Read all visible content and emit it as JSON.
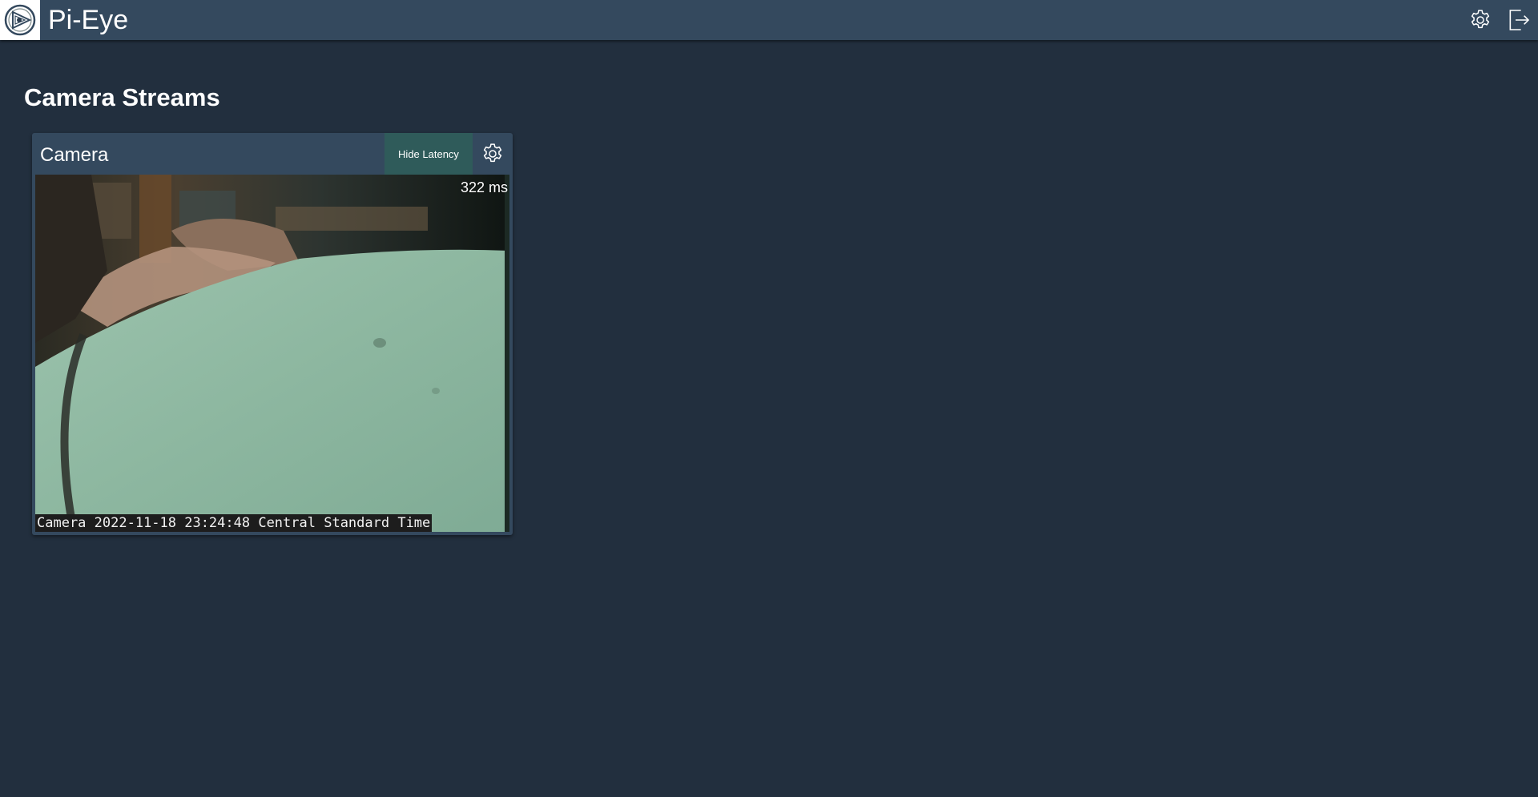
{
  "app": {
    "title": "Pi-Eye",
    "logo_icon": "eye-logo-icon"
  },
  "topbar": {
    "settings_icon": "gear-icon",
    "logout_icon": "logout-icon"
  },
  "page": {
    "heading": "Camera Streams"
  },
  "cameras": [
    {
      "name": "Camera",
      "latency_button_label": "Hide Latency",
      "settings_icon": "gear-icon",
      "latency_text": "322 ms",
      "osd_text": "Camera 2022-11-18 23:24:48 Central Standard Time"
    }
  ],
  "colors": {
    "background": "#222f3e",
    "topbar": "#34495e",
    "card": "#34495e",
    "latency_button": "#2f5b5a"
  }
}
